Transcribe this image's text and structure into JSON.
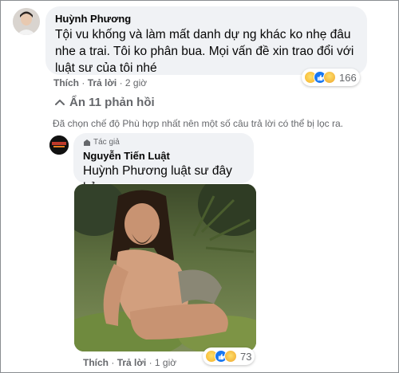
{
  "comment": {
    "author": "Huỳnh Phương",
    "text": "Tội vu khống và làm mất danh dự ng khác ko nhẹ đâu nhe a trai. Tôi ko phân bua. Mọi vấn đề xin trao đổi với luật sư của tôi nhé",
    "like_label": "Thích",
    "reply_label": "Trả lời",
    "time": "2 giờ",
    "reaction_icons": [
      "haha-icon",
      "like-icon",
      "sad-icon"
    ],
    "reaction_count": "166"
  },
  "hide_replies_label": "Ẩn 11 phản hồi",
  "filter_notice": "Đã chọn chế độ Phù hợp nhất nên một số câu trả lời có thể bị lọc ra.",
  "reply": {
    "badge": "Tác giả",
    "author": "Nguyễn Tiến Luật",
    "mention": "Huỳnh Phương",
    "text": " luật sư đây hả",
    "like_label": "Thích",
    "reply_label": "Trả lời",
    "time": "1 giờ",
    "reaction_icons": [
      "haha-icon",
      "like-icon",
      "care-icon"
    ],
    "reaction_count": "73"
  },
  "colors": {
    "bubble": "#f0f2f5",
    "meta_text": "#65676b",
    "like_blue": "#1877f2",
    "haha_yellow": "#f7b125"
  }
}
